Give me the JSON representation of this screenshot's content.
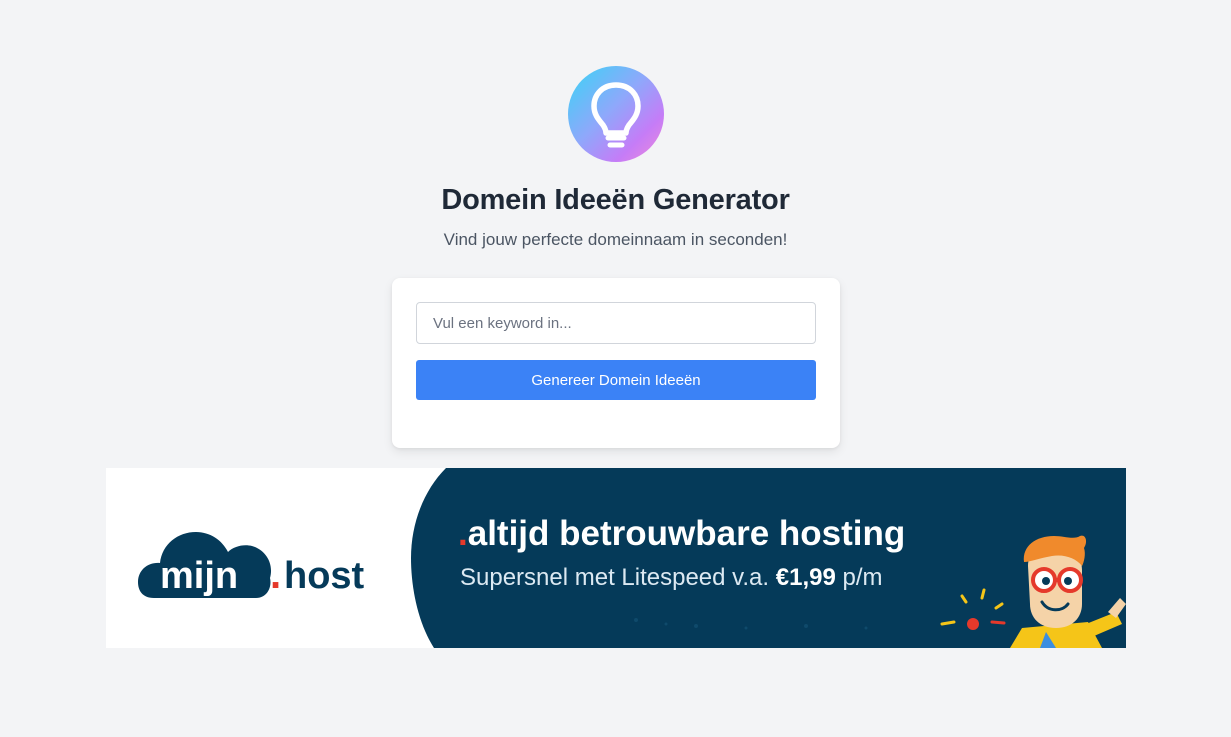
{
  "app": {
    "logo_icon": "lightbulb-icon",
    "title": "Domein Ideeën Generator",
    "subtitle": "Vind jouw perfecte domeinnaam in seconden!"
  },
  "form": {
    "keyword_placeholder": "Vul een keyword in...",
    "keyword_value": "",
    "generate_label": "Genereer Domein Ideeën"
  },
  "ad": {
    "brand_name": "mijn",
    "brand_dot": ".",
    "brand_suffix": "host",
    "headline_dot": ".",
    "headline": "altijd betrouwbare hosting",
    "tagline_prefix": "Supersnel met Litespeed v.a.",
    "tagline_price": "€1,99",
    "tagline_suffix": "p/m",
    "mascot": "nerd-mascot-icon"
  },
  "colors": {
    "background": "#f3f4f6",
    "primary_button": "#3b82f6",
    "ad_dark_blue": "#053a59",
    "ad_red": "#e5392b",
    "title_text": "#1f2937"
  }
}
